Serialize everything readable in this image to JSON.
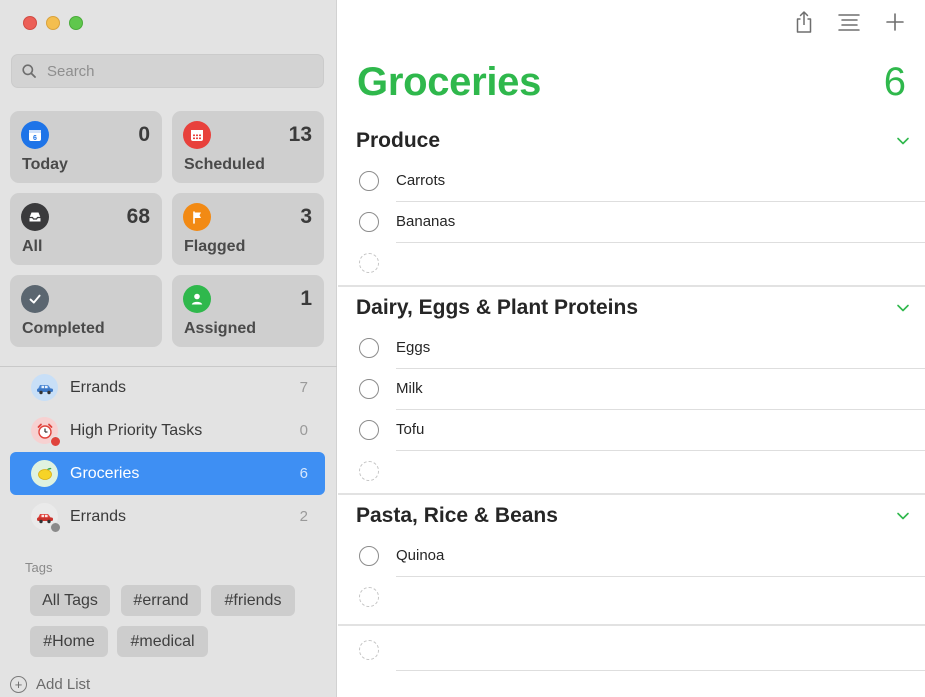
{
  "sidebar": {
    "search_placeholder": "Search",
    "smart_lists": [
      {
        "label": "Today",
        "count": "0",
        "color": "#1e74e8",
        "icon": "calendar-icon"
      },
      {
        "label": "Scheduled",
        "count": "13",
        "color": "#e8413c",
        "icon": "calendar-grid-icon"
      },
      {
        "label": "All",
        "count": "68",
        "color": "#3a3a3c",
        "icon": "tray-icon"
      },
      {
        "label": "Flagged",
        "count": "3",
        "color": "#f28a14",
        "icon": "flag-icon"
      },
      {
        "label": "Completed",
        "count": "",
        "color": "#5b6670",
        "icon": "checkmark-icon"
      },
      {
        "label": "Assigned",
        "count": "1",
        "color": "#2fb84c",
        "icon": "person-icon"
      }
    ],
    "lists": [
      {
        "name": "Errands",
        "count": "7",
        "icon": "car-icon",
        "color": "#c8dff7"
      },
      {
        "name": "High Priority Tasks",
        "count": "0",
        "icon": "alarm-clock-icon",
        "color": "#f7d1d1"
      },
      {
        "name": "Groceries",
        "count": "6",
        "icon": "lemon-icon",
        "color": "#dff2e0"
      },
      {
        "name": "Errands",
        "count": "2",
        "icon": "red-car-icon",
        "color": "#eaeaea"
      }
    ],
    "tags_title": "Tags",
    "tags": [
      "All Tags",
      "#errand",
      "#friends",
      "#Home",
      "#medical"
    ],
    "add_list_label": "Add List"
  },
  "main": {
    "title": "Groceries",
    "total": "6",
    "accent": "#2fb84c",
    "sections": [
      {
        "title": "Produce",
        "tasks": [
          "Carrots",
          "Bananas"
        ]
      },
      {
        "title": "Dairy, Eggs & Plant Proteins",
        "tasks": [
          "Eggs",
          "Milk",
          "Tofu"
        ]
      },
      {
        "title": "Pasta, Rice & Beans",
        "tasks": [
          "Quinoa"
        ]
      }
    ]
  }
}
